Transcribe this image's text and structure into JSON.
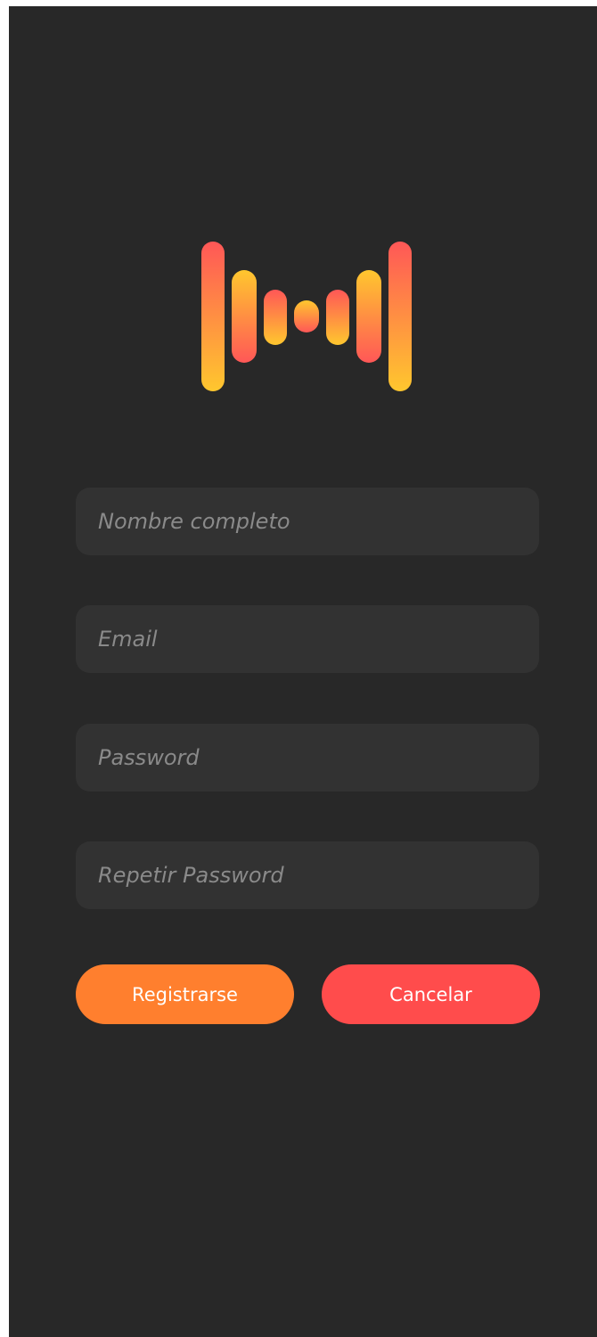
{
  "logo": {
    "icon": "soundwave-logo-icon",
    "gradient_top": "#ff5757",
    "gradient_bottom": "#ffc72e"
  },
  "form": {
    "full_name_placeholder": "Nombre completo",
    "email_placeholder": "Email",
    "password_placeholder": "Password",
    "repeat_password_placeholder": "Repetir Password"
  },
  "buttons": {
    "register_label": "Registrarse",
    "cancel_label": "Cancelar"
  },
  "colors": {
    "background": "#282828",
    "field_background": "#323232",
    "register_button": "#ff7f2e",
    "cancel_button": "#ff4c4c"
  }
}
